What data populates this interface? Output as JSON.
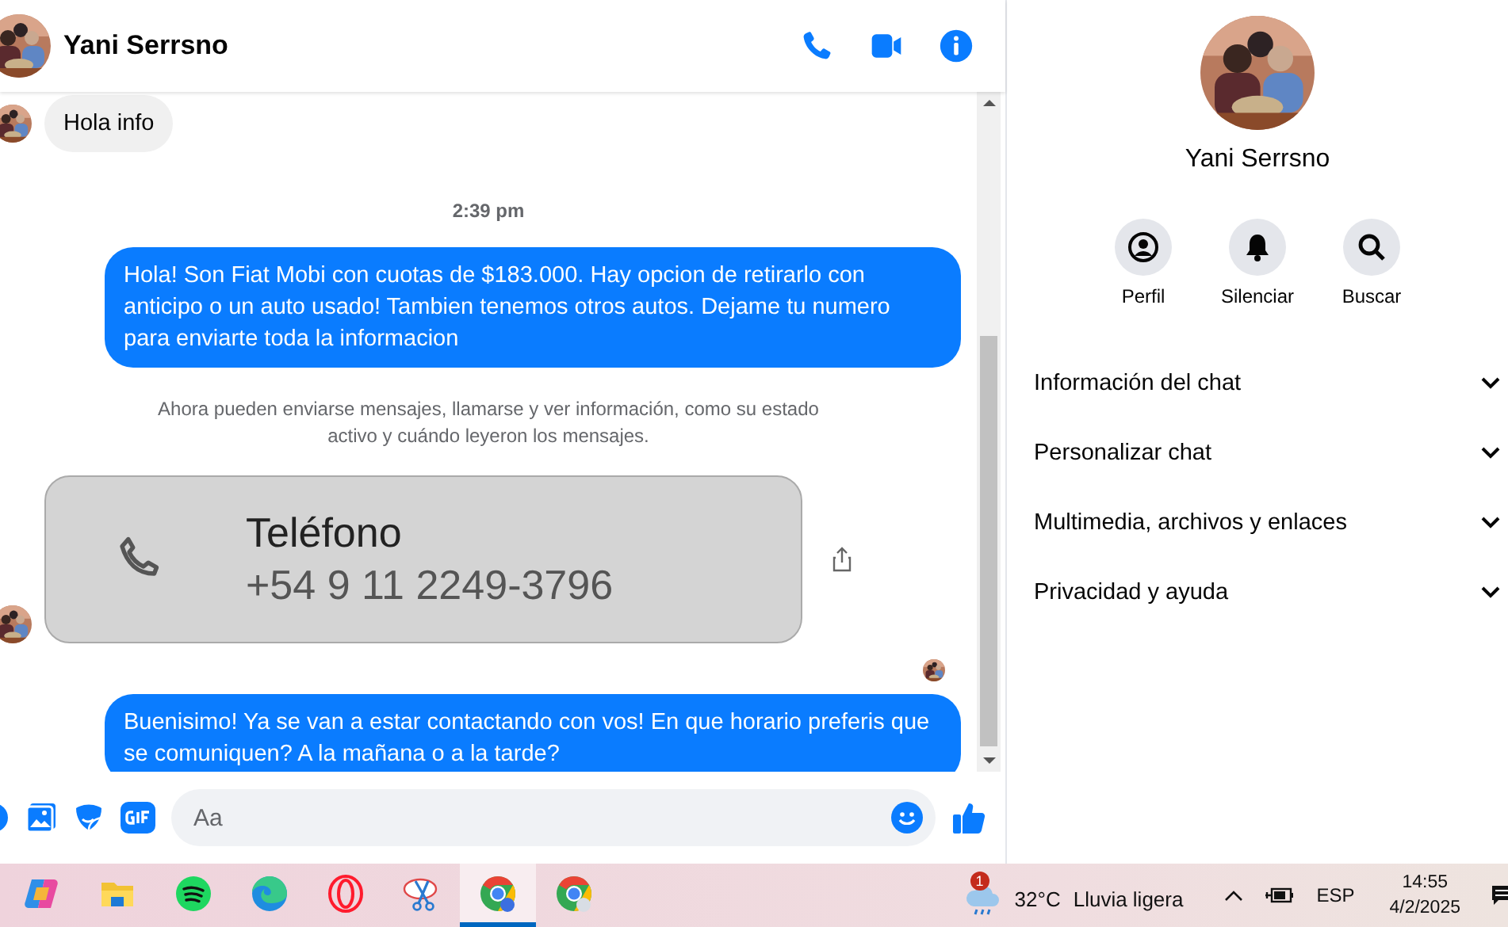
{
  "header": {
    "name": "Yani Serrsno"
  },
  "messages": [
    {
      "kind": "incoming",
      "text": "Hola info"
    },
    {
      "kind": "time",
      "text": "2:39 pm"
    },
    {
      "kind": "outgoing",
      "text": "Hola! Son Fiat Mobi con cuotas de $183.000. Hay opcion de retirarlo con anticipo o un auto usado! Tambien tenemos otros autos. Dejame tu numero para enviarte toda la informacion"
    },
    {
      "kind": "notice",
      "text": "Ahora pueden enviarse mensajes, llamarse y ver información, como su estado activo y cuándo leyeron los mensajes."
    },
    {
      "kind": "contact_card",
      "title": "Teléfono",
      "number": "+54 9 11 2249-3796"
    },
    {
      "kind": "seen"
    },
    {
      "kind": "outgoing",
      "text": "Buenisimo! Ya se van a estar contactando con vos! En que horario preferis que se comuniquen? A la mañana o a la tarde?"
    }
  ],
  "composer": {
    "placeholder": "Aa"
  },
  "panel": {
    "name": "Yani Serrsno",
    "actions": [
      {
        "kind": "profile",
        "label": "Perfil"
      },
      {
        "kind": "mute",
        "label": "Silenciar"
      },
      {
        "kind": "search",
        "label": "Buscar"
      }
    ],
    "sections": [
      {
        "label": "Información del chat",
        "expanded": false
      },
      {
        "label": "Personalizar chat",
        "expanded": false
      },
      {
        "label": "Multimedia, archivos y enlaces",
        "expanded": false
      },
      {
        "label": "Privacidad y ayuda",
        "expanded": false
      }
    ]
  },
  "taskbar": {
    "apps": [
      {
        "kind": "copilot",
        "selected": false
      },
      {
        "kind": "files",
        "selected": false
      },
      {
        "kind": "spotify",
        "selected": false
      },
      {
        "kind": "edge",
        "selected": false
      },
      {
        "kind": "opera",
        "selected": false
      },
      {
        "kind": "snip",
        "selected": false
      },
      {
        "kind": "chrome",
        "selected": true
      },
      {
        "kind": "chrome",
        "selected": false
      }
    ],
    "weather": {
      "badge": "1",
      "temp": "32°C",
      "text": "Lluvia ligera"
    },
    "lang": "ESP",
    "time": "14:55",
    "date": "4/2/2025"
  }
}
